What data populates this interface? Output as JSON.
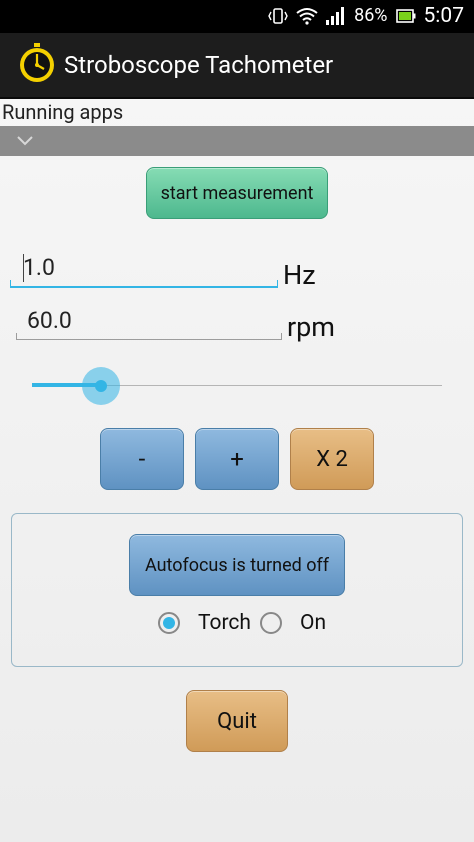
{
  "status_bar": {
    "battery": "86%",
    "time": "5:07"
  },
  "app_bar": {
    "title": "Stroboscope Tachometer"
  },
  "running_apps": {
    "label": "Running apps"
  },
  "controls": {
    "start_label": "start measurement",
    "frequency_value": "1.0",
    "frequency_unit": "Hz",
    "rpm_value": "60.0",
    "rpm_unit": "rpm",
    "slider_fraction": 0.167,
    "minus_label": "-",
    "plus_label": "+",
    "double_label": "X 2"
  },
  "camera_panel": {
    "autofocus_label": "Autofocus is turned off",
    "options": [
      "Torch",
      "On"
    ],
    "selected_option": "Torch"
  },
  "quit_label": "Quit",
  "colors": {
    "accent": "#33b5e5",
    "start_button": "#5bc99a",
    "step_button": "#6fa0cf",
    "double_button": "#dba96a"
  }
}
